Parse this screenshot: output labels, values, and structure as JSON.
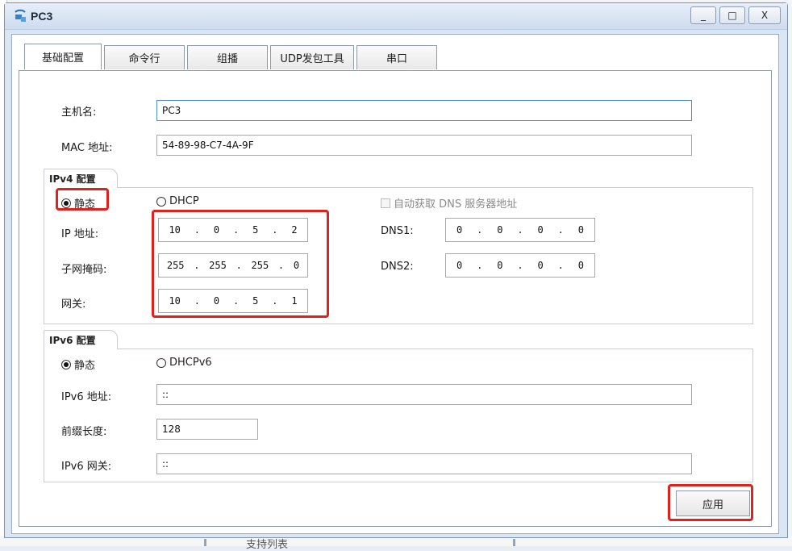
{
  "window": {
    "title": "PC3"
  },
  "tabs": [
    "基础配置",
    "命令行",
    "组播",
    "UDP发包工具",
    "串口"
  ],
  "basic": {
    "hostname_label": "主机名:",
    "hostname_value": "PC3",
    "mac_label": "MAC 地址:",
    "mac_value": "54-89-98-C7-4A-9F"
  },
  "ipv4": {
    "title": "IPv4 配置",
    "static_label": "静态",
    "dhcp_label": "DHCP",
    "auto_dns_label": "自动获取 DNS 服务器地址",
    "ip_label": "IP 地址:",
    "ip": [
      "10",
      "0",
      "5",
      "2"
    ],
    "mask_label": "子网掩码:",
    "mask": [
      "255",
      "255",
      "255",
      "0"
    ],
    "gateway_label": "网关:",
    "gateway": [
      "10",
      "0",
      "5",
      "1"
    ],
    "dns1_label": "DNS1:",
    "dns1": [
      "0",
      "0",
      "0",
      "0"
    ],
    "dns2_label": "DNS2:",
    "dns2": [
      "0",
      "0",
      "0",
      "0"
    ]
  },
  "ipv6": {
    "title": "IPv6 配置",
    "static_label": "静态",
    "dhcp_label": "DHCPv6",
    "addr_label": "IPv6 地址:",
    "addr_value": "::",
    "prefix_label": "前缀长度:",
    "prefix_value": "128",
    "gateway_label": "IPv6 网关:",
    "gateway_value": "::"
  },
  "apply_label": "应用",
  "window_buttons": {
    "minimize": "_",
    "maximize": "□",
    "close": "X"
  },
  "bg_text": "支持列表"
}
